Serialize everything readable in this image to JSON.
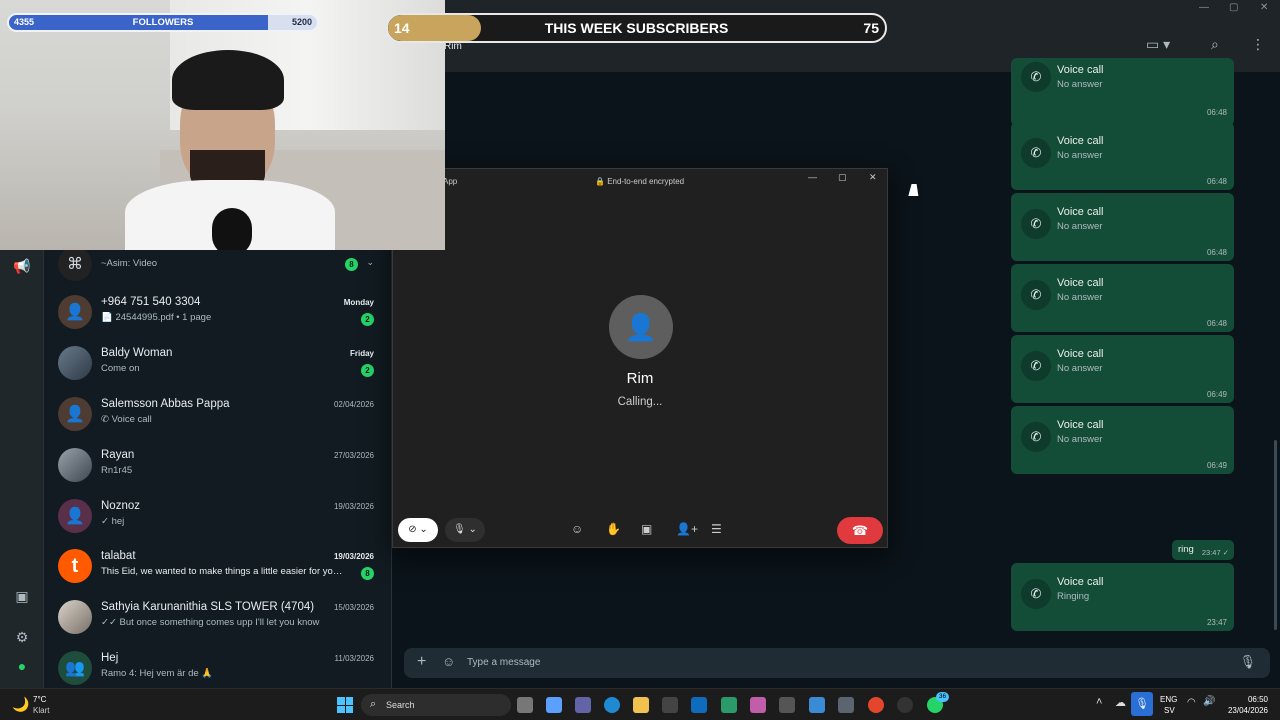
{
  "overlays": {
    "followers": {
      "current": "4355",
      "label": "FOLLOWERS",
      "goal": "5200",
      "progress": 0.84
    },
    "subscribers": {
      "current": "14",
      "label": "THIS WEEK SUBSCRIBERS",
      "goal": "75",
      "progress": 0.187
    }
  },
  "chat_header": {
    "name": "Rim"
  },
  "chat_list": [
    {
      "name": "",
      "preview": "~Asim: Video",
      "date": "",
      "badge": "8",
      "avatar": "group"
    },
    {
      "name": "+964 751 540 3304",
      "preview": "24544995.pdf • 1 page",
      "date": "Monday",
      "date_bold": true,
      "badge": "2",
      "avatar": "person"
    },
    {
      "name": "Baldy Woman",
      "preview": "Come on",
      "date": "Friday",
      "date_bold": true,
      "badge": "2",
      "avatar": "photo"
    },
    {
      "name": "Salemsson Abbas Pappa",
      "preview": "Voice call",
      "date": "02/04/2026",
      "date_bold": false,
      "badge": "",
      "avatar": "person"
    },
    {
      "name": "Rayan",
      "preview": "Rn1r45",
      "date": "27/03/2026",
      "date_bold": false,
      "badge": "",
      "avatar": "photo"
    },
    {
      "name": "Noznoz",
      "preview": "✓ hej",
      "date": "19/03/2026",
      "date_bold": false,
      "badge": "",
      "avatar": "person"
    },
    {
      "name": "talabat",
      "preview": "This Eid, we wanted to make things a little easier for you ...",
      "date": "19/03/2026",
      "date_bold": true,
      "badge": "8",
      "avatar": "talabat"
    },
    {
      "name": "Sathyia Karunanithia SLS TOWER (4704)",
      "preview": "✓✓ But once something comes upp I'll let you know",
      "date": "15/03/2026",
      "date_bold": false,
      "badge": "",
      "avatar": "photo"
    },
    {
      "name": "Hej",
      "preview": "Ramo 4: Hej vem är de 🙏",
      "date": "11/03/2026",
      "date_bold": false,
      "badge": "",
      "avatar": "group"
    }
  ],
  "messages": [
    {
      "title": "Voice call",
      "status": "No answer",
      "time": "06:48"
    },
    {
      "title": "Voice call",
      "status": "No answer",
      "time": "06:48"
    },
    {
      "title": "Voice call",
      "status": "No answer",
      "time": "06:48"
    },
    {
      "title": "Voice call",
      "status": "No answer",
      "time": "06:48"
    },
    {
      "title": "Voice call",
      "status": "No answer",
      "time": "06:49"
    },
    {
      "title": "Voice call",
      "status": "No answer",
      "time": "06:49"
    },
    {
      "title": "Voice call",
      "status": "Ringing",
      "time": "23:47"
    }
  ],
  "text_message": {
    "text": "ring",
    "time": "23:47 ✓"
  },
  "composer": {
    "placeholder": "Type a message"
  },
  "call_window": {
    "app_label": "App",
    "encryption": "End-to-end encrypted",
    "contact": "Rim",
    "status": "Calling..."
  },
  "taskbar": {
    "weather_temp": "7°C",
    "weather_desc": "Klart",
    "search_placeholder": "Search",
    "lang_top": "ENG",
    "lang_bottom": "SV",
    "time": "06:50",
    "date": "23/04/2026",
    "notif_count": "36"
  },
  "colors": {
    "accent": "#25d366",
    "bubble": "#144d37",
    "end_call": "#e0393e"
  }
}
